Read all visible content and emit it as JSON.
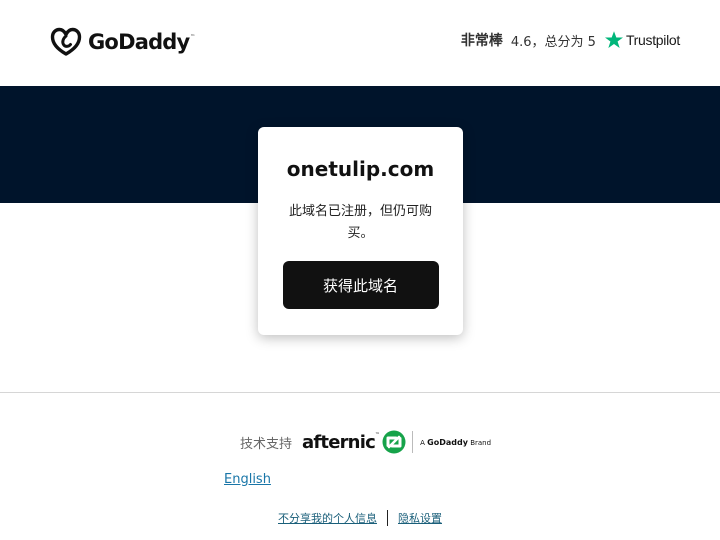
{
  "header": {
    "logo_text": "GoDaddy",
    "logo_tm": "™",
    "rating_word": "非常棒",
    "rating_score": "4.6，总分为 5",
    "trustpilot": "Trustpilot"
  },
  "card": {
    "domain": "onetulip.com",
    "description": "此域名已注册，但仍可购买。",
    "cta_label": "获得此域名"
  },
  "footer": {
    "powered_label": "技术支持",
    "afternic": "afternic",
    "afternic_tm": "™",
    "brand_prefix": "A",
    "brand_name": "GoDaddy",
    "brand_suffix": "Brand",
    "language": "English",
    "links": [
      "不分享我的个人信息",
      "隐私设置"
    ]
  },
  "colors": {
    "band": "#00142b",
    "cta_bg": "#111111",
    "trustpilot_star": "#00b67a",
    "link": "#1976a8"
  },
  "icons": [
    "godaddy-logo-icon",
    "trustpilot-star-icon",
    "afternic-logo-icon"
  ]
}
